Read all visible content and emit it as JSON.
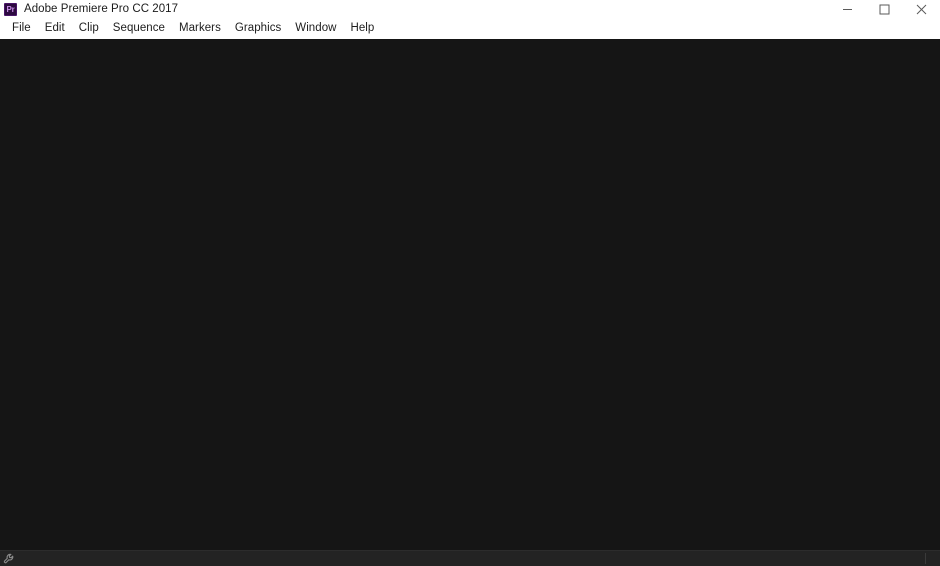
{
  "window": {
    "title": "Adobe Premiere Pro CC 2017",
    "app_icon_label": "Pr",
    "app_icon_color": "#2d0a40",
    "app_icon_text_color": "#c98fe8",
    "titlebar_background": "#ffffff",
    "controls": [
      {
        "name": "minimize",
        "glyph": "—"
      },
      {
        "name": "maximize",
        "glyph": "□"
      },
      {
        "name": "close",
        "glyph": "✕"
      }
    ]
  },
  "menu": {
    "background": "#ffffff",
    "text_color": "#1d1d1d",
    "items": [
      {
        "label": "File"
      },
      {
        "label": "Edit"
      },
      {
        "label": "Clip"
      },
      {
        "label": "Sequence"
      },
      {
        "label": "Markers"
      },
      {
        "label": "Graphics"
      },
      {
        "label": "Window"
      },
      {
        "label": "Help"
      }
    ]
  },
  "workspace": {
    "background": "#151515",
    "content": ""
  },
  "status_bar": {
    "background": "#232323",
    "tool_icon": "wrench-icon",
    "divider_color": "#3a3a3a"
  }
}
